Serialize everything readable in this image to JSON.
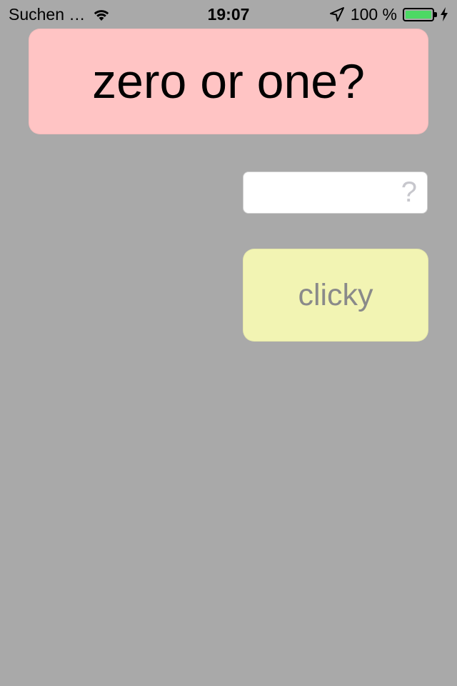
{
  "status_bar": {
    "carrier": "Suchen …",
    "wifi_icon": "wifi-icon",
    "time": "19:07",
    "location_icon": "location-arrow-icon",
    "battery_percent": "100 %",
    "battery_icon": "battery-icon",
    "charging_icon": "charging-bolt-icon",
    "battery_color": "#4cd964"
  },
  "title": {
    "text": "zero or one?",
    "background": "#ffc4c4"
  },
  "answer_input": {
    "value": "",
    "placeholder": "?"
  },
  "button": {
    "label": "clicky",
    "background": "#f2f4b3"
  },
  "background_color": "#a9a9a9"
}
